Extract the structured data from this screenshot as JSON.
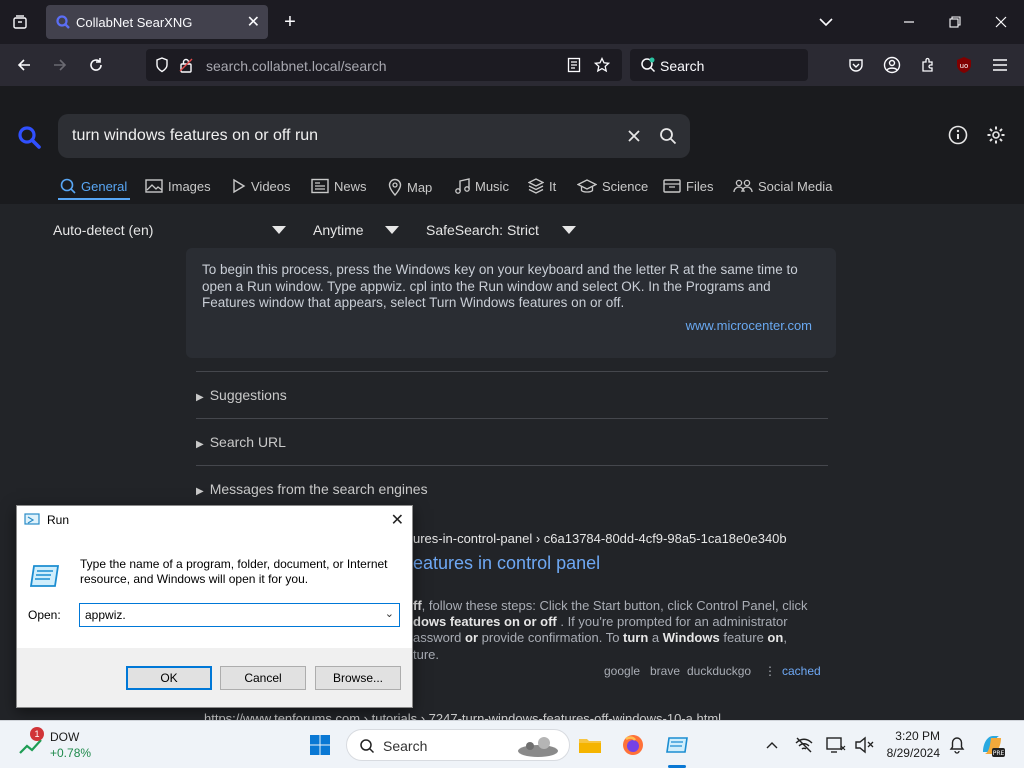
{
  "browser": {
    "tab_title": "CollabNet SearXNG",
    "url_host": "search.collabnet.local",
    "url_path": "/search",
    "search_placeholder": "Search"
  },
  "search": {
    "query": "turn windows features on or off run",
    "categories": [
      "General",
      "Images",
      "Videos",
      "News",
      "Map",
      "Music",
      "It",
      "Science",
      "Files",
      "Social Media"
    ],
    "active_category": "General",
    "language_filter": "Auto-detect (en)",
    "time_filter": "Anytime",
    "safesearch_filter": "SafeSearch: Strict"
  },
  "answer": {
    "text": "To begin this process, press the Windows key on your keyboard and the letter R at the same time to open a Run window. Type appwiz. cpl into the Run window and select OK. In the Programs and Features window that appears, select Turn Windows features on or off.",
    "source": "www.microcenter.com"
  },
  "sections": {
    "suggestions": "Suggestions",
    "search_url": "Search URL",
    "engines": "Messages from the search engines"
  },
  "result1": {
    "url_tail": "ures-in-control-panel › c6a13784-80dd-4cf9-98a5-1ca18e0e340b",
    "title_tail": "eatures in control panel",
    "snippet_l1_a": "ff",
    "snippet_l1_b": ", follow these steps: Click the Start button, click Control Panel, click",
    "snippet_l2_a": "dows features on or off",
    "snippet_l2_b": " . If you're prompted for an administrator",
    "snippet_l3_a": "assword ",
    "snippet_l3_or": "or",
    "snippet_l3_b": " provide confirmation. To ",
    "snippet_l3_turn": "turn",
    "snippet_l3_c": " a ",
    "snippet_l3_win": "Windows",
    "snippet_l3_d": " feature ",
    "snippet_l3_on": "on",
    "snippet_l3_e": ",",
    "snippet_l4": "ture.",
    "engines": [
      "google",
      "brave",
      "duckduckgo"
    ],
    "cached": "cached"
  },
  "result2": {
    "url_partial": "https://www.tenforums.com › tutorials › 7247-turn-windows-features-off-windows-10-a.html"
  },
  "run_dialog": {
    "title": "Run",
    "description": "Type the name of a program, folder, document, or Internet resource, and Windows will open it for you.",
    "open_label": "Open:",
    "open_value": "appwiz.",
    "ok": "OK",
    "cancel": "Cancel",
    "browse": "Browse..."
  },
  "taskbar": {
    "stock_name": "DOW",
    "stock_change": "+0.78%",
    "stock_badge": "1",
    "search_label": "Search",
    "time": "3:20 PM",
    "date": "8/29/2024"
  },
  "colors": {
    "accent": "#58a6f4",
    "link": "#6ea8f4",
    "page_bg": "#222428",
    "dialog_focus": "#0078d7"
  }
}
